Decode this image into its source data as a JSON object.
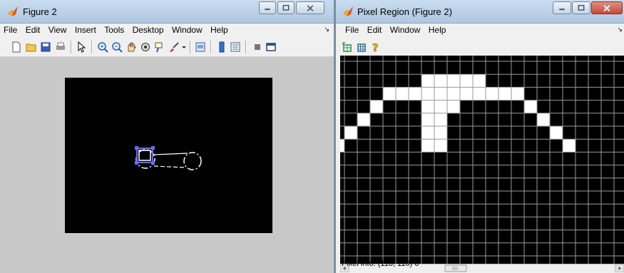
{
  "figure_window": {
    "title": "Figure 2",
    "menu": [
      "File",
      "Edit",
      "View",
      "Insert",
      "Tools",
      "Desktop",
      "Window",
      "Help"
    ],
    "toolbar_icons": [
      "new-file-icon",
      "open-icon",
      "save-icon",
      "print-icon",
      "pointer-icon",
      "zoom-in-icon",
      "zoom-out-icon",
      "pan-icon",
      "rotate-icon",
      "data-cursor-icon",
      "brush-icon",
      "link-icon",
      "colorbar-icon",
      "legend-icon",
      "hide-tools-icon",
      "show-tools-icon"
    ]
  },
  "pixel_region_window": {
    "title": "Pixel Region (Figure 2)",
    "menu": [
      "File",
      "Edit",
      "Window",
      "Help"
    ],
    "toolbar_icons": [
      "copy-position-icon",
      "pixel-values-icon",
      "help-icon"
    ],
    "status_label": "Pixel info:",
    "status_coords": "(118, 110)",
    "status_value": "0"
  },
  "colors": {
    "title_bar": "#bcd2e8",
    "close_button": "#c44b3c",
    "figure_background": "#c8c8c8",
    "roi_outline": "#5a5aff"
  },
  "pixel_grid": {
    "cols": 21,
    "rows": 15,
    "white_cells": [
      [
        1,
        7
      ],
      [
        2,
        7
      ],
      [
        3,
        7
      ],
      [
        4,
        7
      ],
      [
        5,
        7
      ],
      [
        6,
        7
      ],
      [
        1,
        8
      ],
      [
        2,
        8
      ],
      [
        3,
        8
      ],
      [
        4,
        8
      ],
      [
        5,
        8
      ],
      [
        6,
        8
      ],
      [
        1,
        9
      ],
      [
        2,
        9
      ],
      [
        3,
        9
      ],
      [
        1,
        10
      ],
      [
        2,
        10
      ],
      [
        1,
        11
      ],
      [
        2,
        11
      ],
      [
        2,
        4
      ],
      [
        2,
        5
      ],
      [
        2,
        6
      ],
      [
        2,
        12
      ],
      [
        2,
        13
      ],
      [
        2,
        14
      ],
      [
        3,
        3
      ],
      [
        3,
        15
      ],
      [
        4,
        2
      ],
      [
        4,
        16
      ],
      [
        5,
        1
      ],
      [
        5,
        17
      ],
      [
        6,
        0
      ],
      [
        6,
        18
      ]
    ]
  }
}
